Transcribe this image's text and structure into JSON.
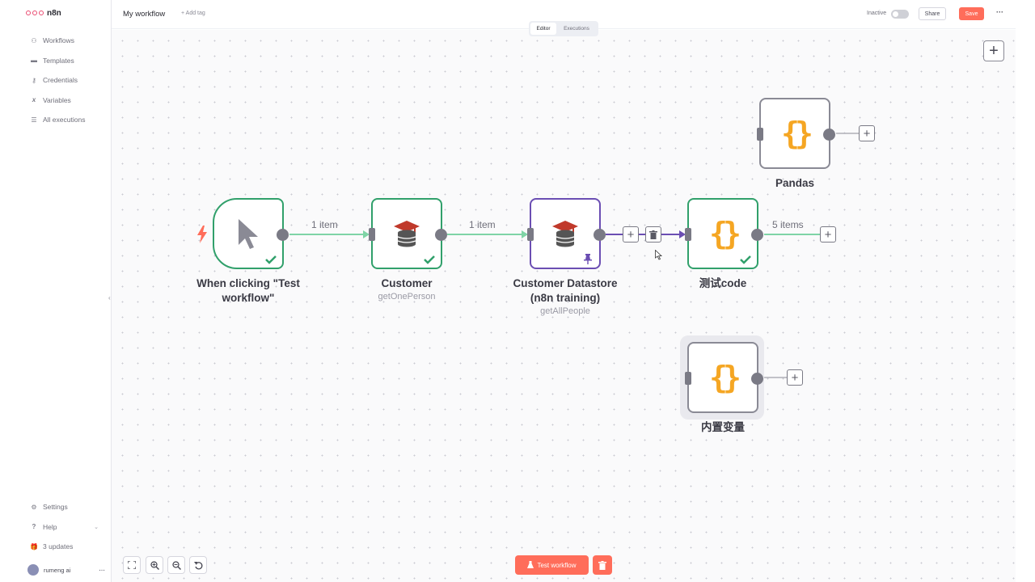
{
  "app": {
    "name": "n8n",
    "brand_color": "#ea4b71"
  },
  "sidebar": {
    "items": [
      {
        "label": "Workflows",
        "icon": "workflows-icon"
      },
      {
        "label": "Templates",
        "icon": "templates-icon"
      },
      {
        "label": "Credentials",
        "icon": "key-icon"
      },
      {
        "label": "Variables",
        "icon": "variables-icon"
      },
      {
        "label": "All executions",
        "icon": "list-icon"
      }
    ],
    "bottom": [
      {
        "label": "Settings",
        "icon": "gear-icon"
      },
      {
        "label": "Help",
        "icon": "help-icon"
      },
      {
        "label": "3 updates",
        "icon": "gift-icon"
      }
    ],
    "user": {
      "name": "rumeng ai"
    }
  },
  "header": {
    "workflow_name": "My workflow",
    "add_tag": "+ Add tag",
    "status_label": "Inactive",
    "share_label": "Share",
    "save_label": "Save",
    "tabs": [
      {
        "label": "Editor",
        "active": true
      },
      {
        "label": "Executions",
        "active": false
      }
    ]
  },
  "nodes": {
    "trigger": {
      "title": "When clicking \"Test workflow\"",
      "status": "success"
    },
    "customer": {
      "title": "Customer",
      "subtitle": "getOnePerson",
      "status": "success"
    },
    "datastore": {
      "title": "Customer Datastore (n8n training)",
      "subtitle": "getAllPeople",
      "pinned": true
    },
    "test_code": {
      "title": "测试code",
      "status": "success"
    },
    "pandas": {
      "title": "Pandas"
    },
    "builtin_vars": {
      "title": "内置变量"
    }
  },
  "connections": {
    "c1": "1 item",
    "c2": "1 item",
    "c4": "5 items"
  },
  "footer": {
    "test_button": "Test workflow"
  },
  "colors": {
    "success": "#31a06b",
    "accent": "#ff6d5a",
    "pinned": "#6b4eb3",
    "code": "#f5a623",
    "edge_success": "#7fd4a6"
  }
}
